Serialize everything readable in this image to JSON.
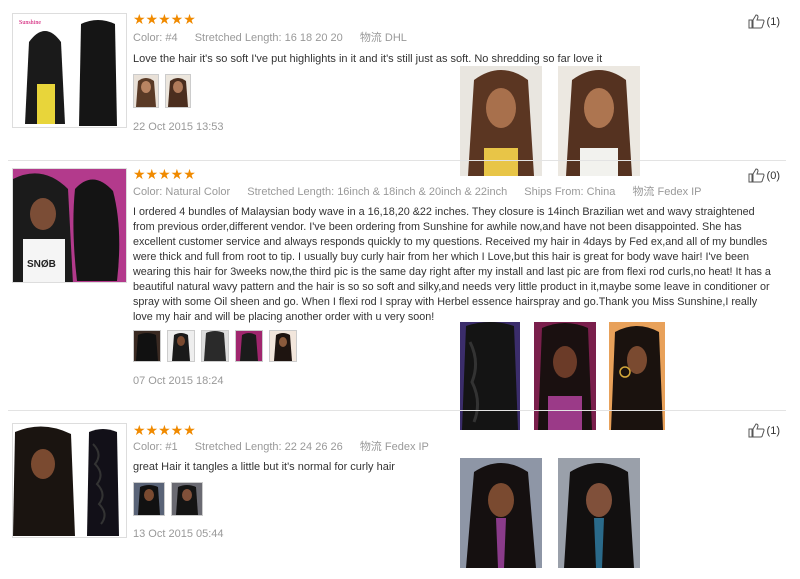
{
  "reviews": [
    {
      "stars": "★★★★★",
      "meta": {
        "color_label": "Color:",
        "color_value": "#4",
        "length_label": "Stretched Length:",
        "length_value": "16 18 20 20",
        "ship_label": "物流",
        "ship_value": "DHL"
      },
      "text": "Love the hair it's so soft I've put highlights in it and it's still just as soft. No shredding so far love it",
      "date": "22 Oct 2015 13:53",
      "helpful_count": "(1)",
      "thumb_count": 2,
      "photo_count": 2
    },
    {
      "stars": "★★★★★",
      "meta": {
        "color_label": "Color:",
        "color_value": "Natural Color",
        "length_label": "Stretched Length:",
        "length_value": "16inch & 18inch & 20inch & 22inch",
        "from_label": "Ships From:",
        "from_value": "China",
        "ship_label": "物流",
        "ship_value": "Fedex IP"
      },
      "text": "I ordered 4 bundles of Malaysian body wave in a 16,18,20 &22 inches. They closure is 14inch Brazilian wet and wavy straightened from previous order,different vendor. I've been ordering from Sunshine for awhile now,and have not been disappointed. She has excellent customer service and always responds quickly to my questions. Received my hair in 4days by Fed ex,and all of my bundles were thick and full from root to tip. I usually buy curly hair from her which I Love,but this hair is great for body wave hair! I've been wearing this hair for 3weeks now,the third pic is the same day right after my install and last pic are from flexi rod curls,no heat! It has a beautiful natural wavy pattern and the hair is so so soft and silky,and needs very little product in it,maybe some leave in conditioner or spray with some Oil sheen and go. When I flexi rod I spray with Herbel essence hairspray and go.Thank you Miss Sunshine,I really love my hair and will be placing another order with u very soon!",
      "date": "07 Oct 2015 18:24",
      "helpful_count": "(0)",
      "thumb_count": 5,
      "photo_count": 3
    },
    {
      "stars": "★★★★★",
      "meta": {
        "color_label": "Color:",
        "color_value": "#1",
        "length_label": "Stretched Length:",
        "length_value": "22 24 26 26",
        "ship_label": "物流",
        "ship_value": "Fedex IP"
      },
      "text": "great Hair it tangles a little but it's normal for curly hair",
      "date": "13 Oct 2015 05:44",
      "helpful_count": "(1)",
      "thumb_count": 2,
      "photo_count": 2
    }
  ],
  "colors": {
    "star": "#f08a00",
    "label": "#999999",
    "text": "#333333"
  }
}
